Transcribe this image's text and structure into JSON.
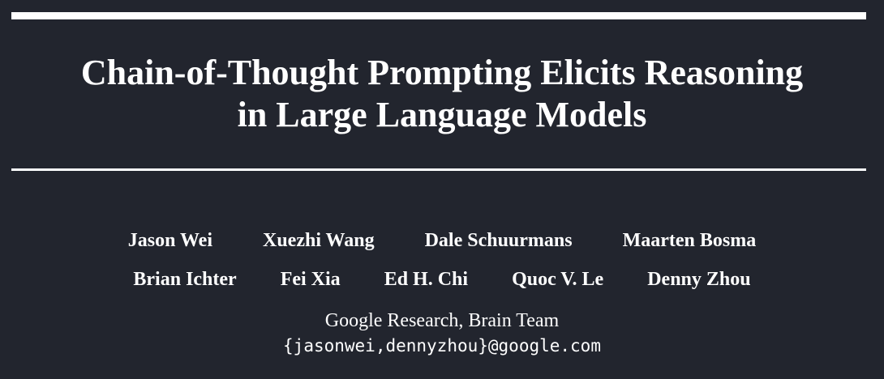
{
  "title": {
    "line1": "Chain-of-Thought Prompting Elicits Reasoning",
    "line2": "in Large Language Models"
  },
  "authors": {
    "row1": [
      "Jason Wei",
      "Xuezhi Wang",
      "Dale Schuurmans",
      "Maarten Bosma"
    ],
    "row2": [
      "Brian Ichter",
      "Fei Xia",
      "Ed H. Chi",
      "Quoc V. Le",
      "Denny Zhou"
    ]
  },
  "affiliation": "Google Research, Brain Team",
  "email": "{jasonwei,dennyzhou}@google.com"
}
